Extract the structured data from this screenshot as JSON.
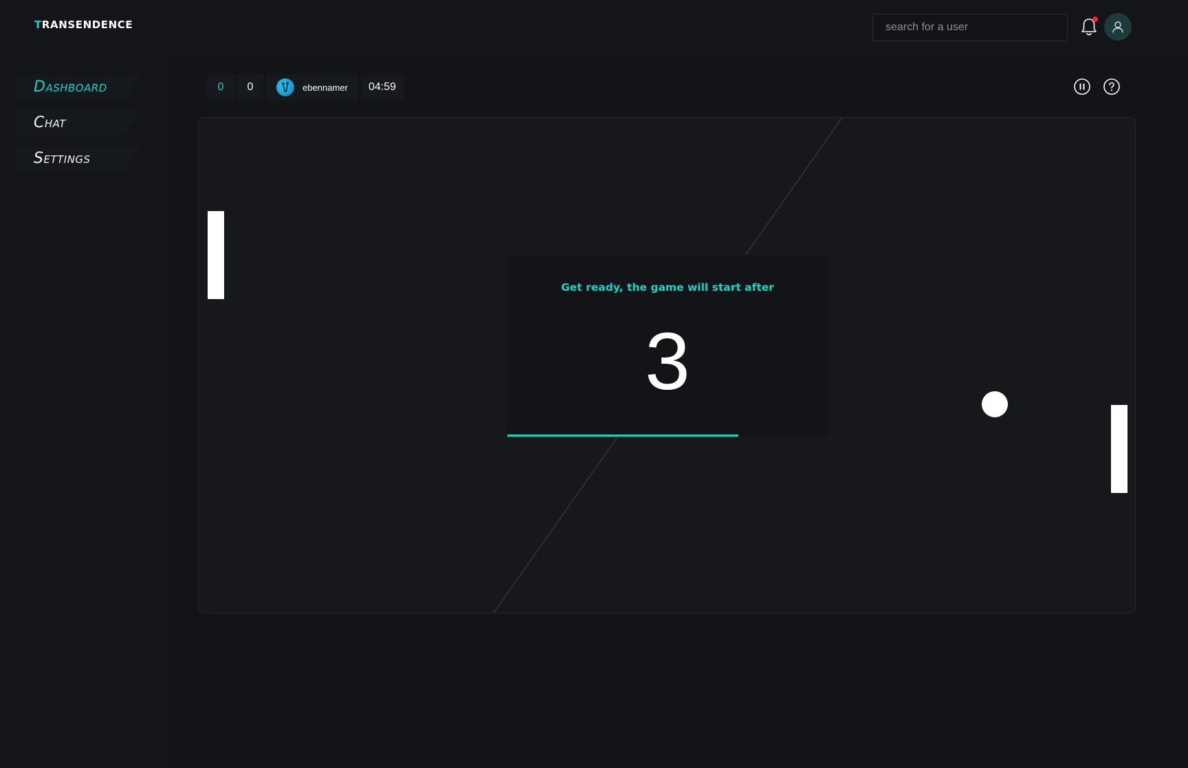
{
  "app": {
    "logo_first": "T",
    "logo_rest": "RANSENDENCE",
    "accent_color": "#19d3c5"
  },
  "header": {
    "search_placeholder": "search for a user",
    "notification_icon": "bell-icon",
    "has_unread_notification": true,
    "profile_icon": "user-icon"
  },
  "sidebar": {
    "items": [
      {
        "label": "Dashboard",
        "active": true
      },
      {
        "label": "Chat",
        "active": false
      },
      {
        "label": "Settings",
        "active": false
      }
    ]
  },
  "game": {
    "player_score": "0",
    "opponent_score": "0",
    "opponent_name": "ebennamer",
    "timer": "04:59",
    "pause_icon": "pause-icon",
    "help_icon": "help-icon",
    "overlay_message": "Get ready, the game will start after",
    "countdown": "3",
    "countdown_progress": 0.72
  }
}
